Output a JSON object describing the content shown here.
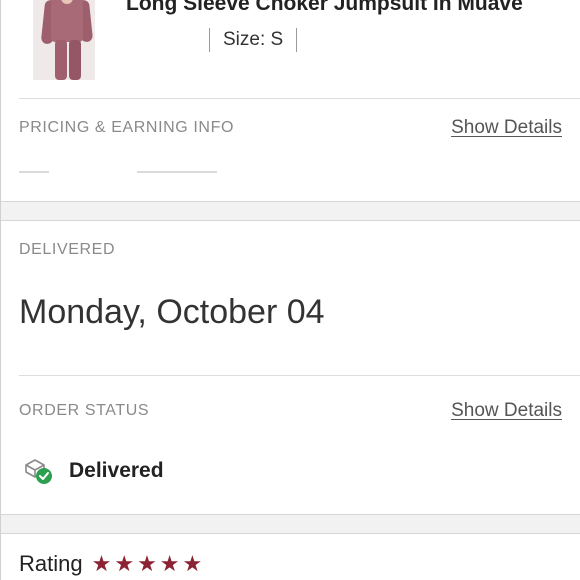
{
  "product": {
    "title": "Long Sleeve Choker Jumpsuit In Muave",
    "size": "Size: S",
    "image_icon": "product-photo"
  },
  "pricing": {
    "label": "PRICING & EARNING INFO",
    "show_details": "Show Details"
  },
  "delivered": {
    "label": "DELIVERED",
    "date": "Monday, October 04"
  },
  "order_status": {
    "label": "ORDER STATUS",
    "show_details": "Show Details",
    "status": "Delivered",
    "icon": "delivered-package-check-icon",
    "check_color": "#2e9e4f"
  },
  "rating": {
    "label": "Rating",
    "stars": 5,
    "star_color": "#8b2332"
  }
}
